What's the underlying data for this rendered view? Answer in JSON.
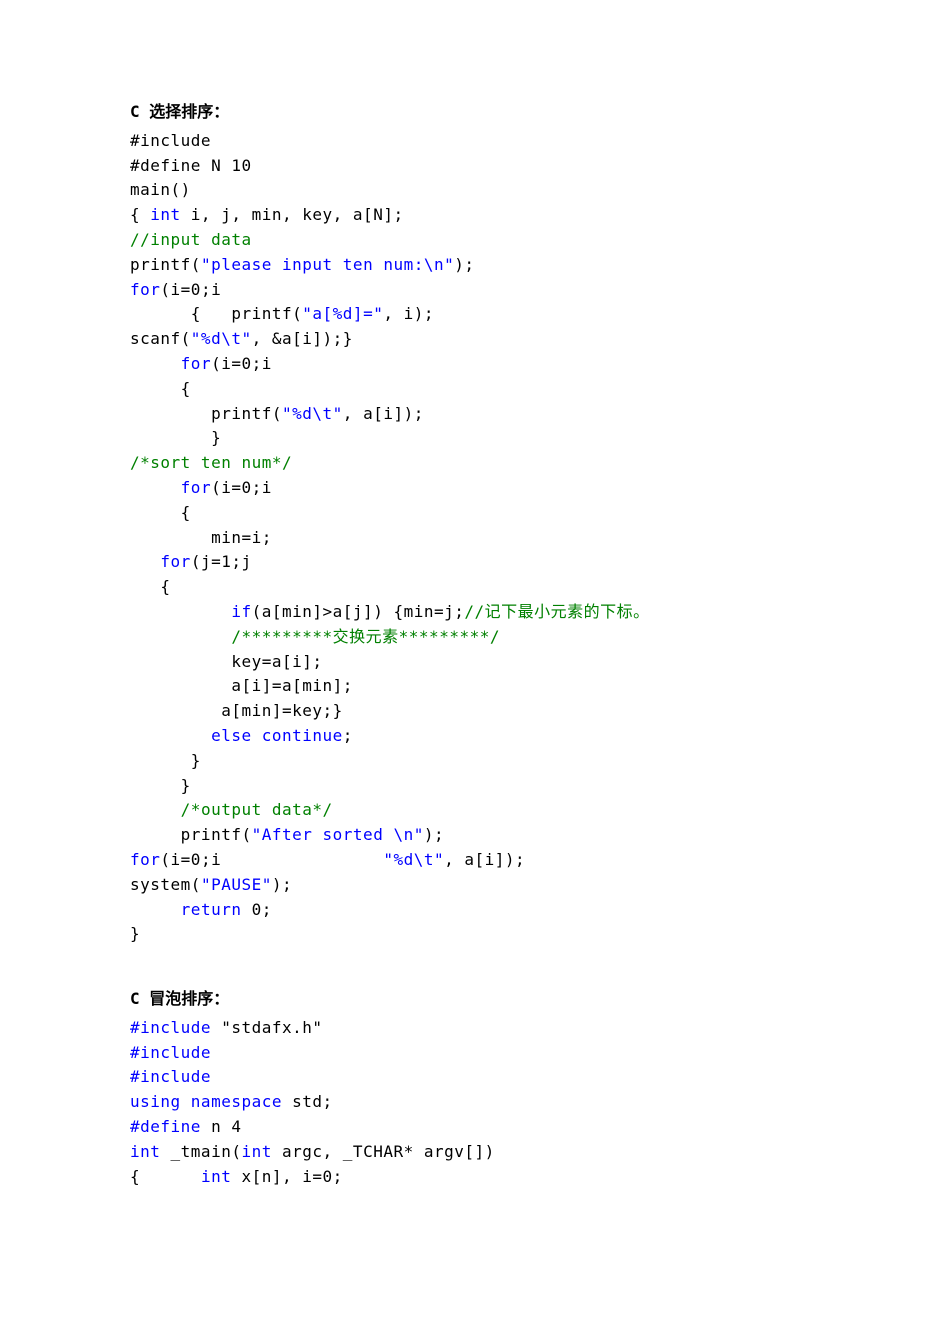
{
  "section1": {
    "title": "C 选择排序：",
    "lines": [
      [
        [
          "blk",
          "#include"
        ]
      ],
      [
        [
          "blk",
          "#define N 10"
        ]
      ],
      [
        [
          "blk",
          "main()"
        ]
      ],
      [
        [
          "blk",
          "{ "
        ],
        [
          "kw",
          "int "
        ],
        [
          "blk",
          "i, j, min, key, a[N];"
        ]
      ],
      [
        [
          "gr",
          "//input data"
        ]
      ],
      [
        [
          "blk",
          "printf("
        ],
        [
          "kw",
          "\"please input ten num:\\n\""
        ],
        [
          "blk",
          ");"
        ]
      ],
      [
        [
          "kw",
          "for"
        ],
        [
          "blk",
          "(i=0;i"
        ]
      ],
      [
        [
          "blk",
          "      {   printf("
        ],
        [
          "kw",
          "\"a[%d]=\""
        ],
        [
          "blk",
          ", i);"
        ]
      ],
      [
        [
          "blk",
          "scanf("
        ],
        [
          "kw",
          "\"%d\\t\""
        ],
        [
          "blk",
          ", &a[i]);}"
        ]
      ],
      [
        [
          "blk",
          "     "
        ],
        [
          "kw",
          "for"
        ],
        [
          "blk",
          "(i=0;i"
        ]
      ],
      [
        [
          "blk",
          "     {"
        ]
      ],
      [
        [
          "blk",
          "        printf("
        ],
        [
          "kw",
          "\"%d\\t\""
        ],
        [
          "blk",
          ", a[i]);"
        ]
      ],
      [
        [
          "blk",
          "        }"
        ]
      ],
      [
        [
          "gr",
          "/*sort ten num*/"
        ]
      ],
      [
        [
          "blk",
          "     "
        ],
        [
          "kw",
          "for"
        ],
        [
          "blk",
          "(i=0;i"
        ]
      ],
      [
        [
          "blk",
          "     {"
        ]
      ],
      [
        [
          "blk",
          "        min=i;"
        ]
      ],
      [
        [
          "blk",
          "   "
        ],
        [
          "kw",
          "for"
        ],
        [
          "blk",
          "(j=1;j"
        ]
      ],
      [
        [
          "blk",
          "   {"
        ]
      ],
      [
        [
          "blk",
          "          "
        ],
        [
          "kw",
          "if"
        ],
        [
          "blk",
          "(a[min]>a[j]) {min=j;"
        ],
        [
          "gr",
          "//记下最小元素的下标。"
        ]
      ],
      [
        [
          "blk",
          "          "
        ],
        [
          "gr",
          "/*********交换元素*********/"
        ]
      ],
      [
        [
          "blk",
          "          key=a[i];"
        ]
      ],
      [
        [
          "blk",
          "          a[i]=a[min];"
        ]
      ],
      [
        [
          "blk",
          "         a[min]=key;}"
        ]
      ],
      [
        [
          "blk",
          "        "
        ],
        [
          "kw",
          "else continue"
        ],
        [
          "blk",
          ";"
        ]
      ],
      [
        [
          "blk",
          "      }"
        ]
      ],
      [
        [
          "blk",
          "     }"
        ]
      ],
      [
        [
          "blk",
          "     "
        ],
        [
          "gr",
          "/*output data*/"
        ]
      ],
      [
        [
          "blk",
          "     printf("
        ],
        [
          "kw",
          "\"After sorted \\n\""
        ],
        [
          "blk",
          ");"
        ]
      ],
      [
        [
          "kw",
          "for"
        ],
        [
          "blk",
          "(i=0;i                "
        ],
        [
          "kw",
          "\"%d\\t\""
        ],
        [
          "blk",
          ", a[i]);"
        ]
      ],
      [
        [
          "blk",
          "system("
        ],
        [
          "kw",
          "\"PAUSE\""
        ],
        [
          "blk",
          ");"
        ]
      ],
      [
        [
          "blk",
          "     "
        ],
        [
          "kw",
          "return "
        ],
        [
          "blk",
          "0;"
        ]
      ],
      [
        [
          "blk",
          "}"
        ]
      ]
    ]
  },
  "section2": {
    "title": "C 冒泡排序：",
    "lines": [
      [
        [
          "kw",
          "#include "
        ],
        [
          "blk",
          "\"stdafx.h\""
        ]
      ],
      [
        [
          "kw",
          "#include"
        ]
      ],
      [
        [
          "kw",
          "#include"
        ]
      ],
      [
        [
          "kw",
          "using namespace "
        ],
        [
          "blk",
          "std;"
        ]
      ],
      [
        [
          "kw",
          "#define "
        ],
        [
          "blk",
          "n 4"
        ]
      ],
      [
        [
          "kw",
          "int "
        ],
        [
          "blk",
          "_tmain("
        ],
        [
          "kw",
          "int "
        ],
        [
          "blk",
          "argc, _TCHAR* argv[])"
        ]
      ],
      [
        [
          "blk",
          "{      "
        ],
        [
          "kw",
          "int "
        ],
        [
          "blk",
          "x[n], i=0;"
        ]
      ]
    ]
  }
}
